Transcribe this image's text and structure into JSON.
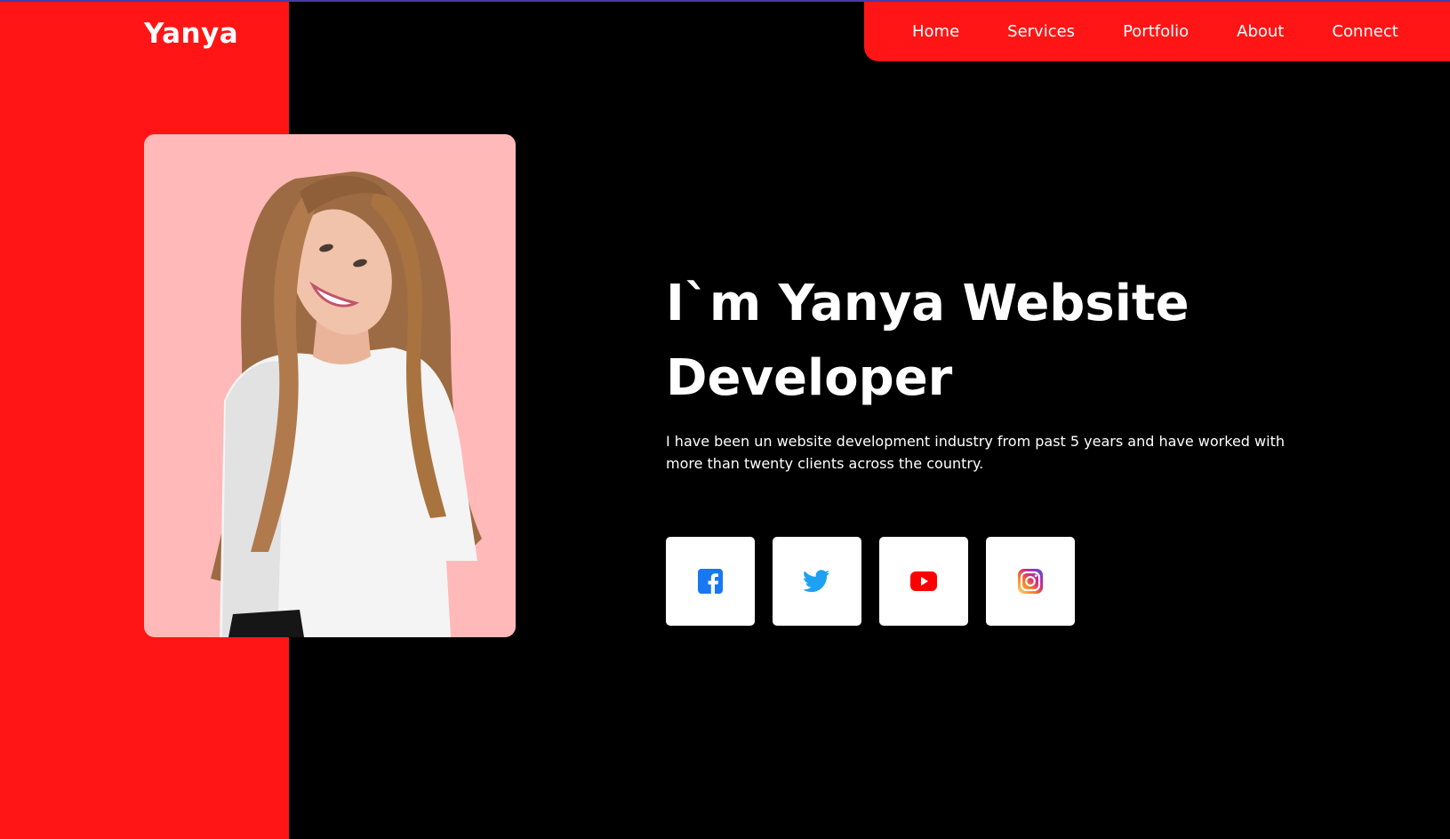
{
  "brand": {
    "name": "Yanya"
  },
  "nav": {
    "items": [
      {
        "label": "Home"
      },
      {
        "label": "Services"
      },
      {
        "label": "Portfolio"
      },
      {
        "label": "About"
      },
      {
        "label": "Connect"
      }
    ]
  },
  "hero": {
    "title": "I`m Yanya Website Developer",
    "description": "I have been un website development industry from past 5 years and have worked with more than twenty clients across the country.",
    "photo_icon": "portrait-photo"
  },
  "socials": [
    {
      "icon": "facebook-icon",
      "color": "#1877f2"
    },
    {
      "icon": "twitter-icon",
      "color": "#1da1f2"
    },
    {
      "icon": "youtube-icon",
      "color": "#ff0000"
    },
    {
      "icon": "instagram-icon",
      "color": "#e1306c"
    }
  ],
  "colors": {
    "accent": "#ff1515",
    "background": "#000000",
    "photo_background": "#ffb9b9",
    "text": "#ffffff"
  }
}
